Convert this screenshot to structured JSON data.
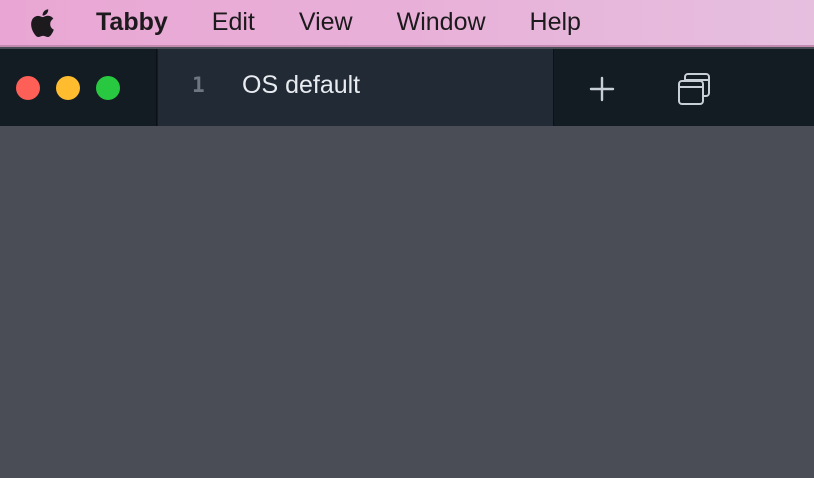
{
  "menubar": {
    "apple_icon": "apple-logo-icon",
    "app_name": "Tabby",
    "items": [
      "Edit",
      "View",
      "Window",
      "Help"
    ]
  },
  "window": {
    "traffic_lights": {
      "close": "#fe5f57",
      "minimize": "#febc2e",
      "maximize": "#28c840"
    },
    "tabs": [
      {
        "index": "1",
        "title": "OS default"
      }
    ],
    "actions": {
      "new_tab_icon": "plus-icon",
      "profiles_icon": "window-stack-icon"
    }
  },
  "colors": {
    "titlebar": "#131b23",
    "active_tab": "#222a35",
    "terminal_bg": "#4a4d55",
    "menubar": "#e8b0d8"
  }
}
